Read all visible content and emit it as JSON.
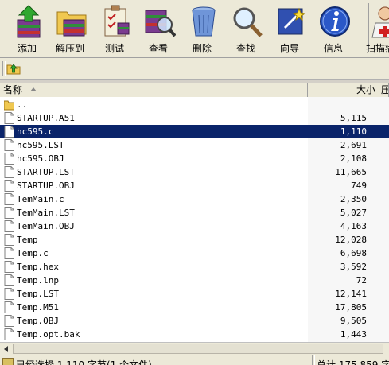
{
  "toolbar": {
    "add": "添加",
    "extract": "解压到",
    "test": "测试",
    "view": "查看",
    "delete": "删除",
    "find": "查找",
    "wizard": "向导",
    "info": "信息",
    "scan": "扫描病"
  },
  "columns": {
    "name": "名称",
    "size": "大小",
    "type": "压"
  },
  "files": [
    {
      "name": "..",
      "size": "",
      "icon": "folder-icon"
    },
    {
      "name": "STARTUP.A51",
      "size": "5,115",
      "icon": "file-icon"
    },
    {
      "name": "hc595.c",
      "size": "1,110",
      "icon": "file-icon",
      "selected": true
    },
    {
      "name": "hc595.LST",
      "size": "2,691",
      "icon": "file-icon"
    },
    {
      "name": "hc595.OBJ",
      "size": "2,108",
      "icon": "file-icon"
    },
    {
      "name": "STARTUP.LST",
      "size": "11,665",
      "icon": "file-icon"
    },
    {
      "name": "STARTUP.OBJ",
      "size": "749",
      "icon": "file-icon"
    },
    {
      "name": "TemMain.c",
      "size": "2,350",
      "icon": "file-icon"
    },
    {
      "name": "TemMain.LST",
      "size": "5,027",
      "icon": "file-icon"
    },
    {
      "name": "TemMain.OBJ",
      "size": "4,163",
      "icon": "file-icon"
    },
    {
      "name": "Temp",
      "size": "12,028",
      "icon": "file-icon"
    },
    {
      "name": "Temp.c",
      "size": "6,698",
      "icon": "file-icon"
    },
    {
      "name": "Temp.hex",
      "size": "3,592",
      "icon": "file-icon"
    },
    {
      "name": "Temp.lnp",
      "size": "72",
      "icon": "file-icon"
    },
    {
      "name": "Temp.LST",
      "size": "12,141",
      "icon": "file-icon"
    },
    {
      "name": "Temp.M51",
      "size": "17,805",
      "icon": "file-icon"
    },
    {
      "name": "Temp.OBJ",
      "size": "9,505",
      "icon": "file-icon"
    },
    {
      "name": "Temp.opt.bak",
      "size": "1,443",
      "icon": "file-icon"
    }
  ],
  "status": {
    "left": "已经选择 1,110 字节(1 个文件)",
    "right": "总计 175,859 字"
  }
}
